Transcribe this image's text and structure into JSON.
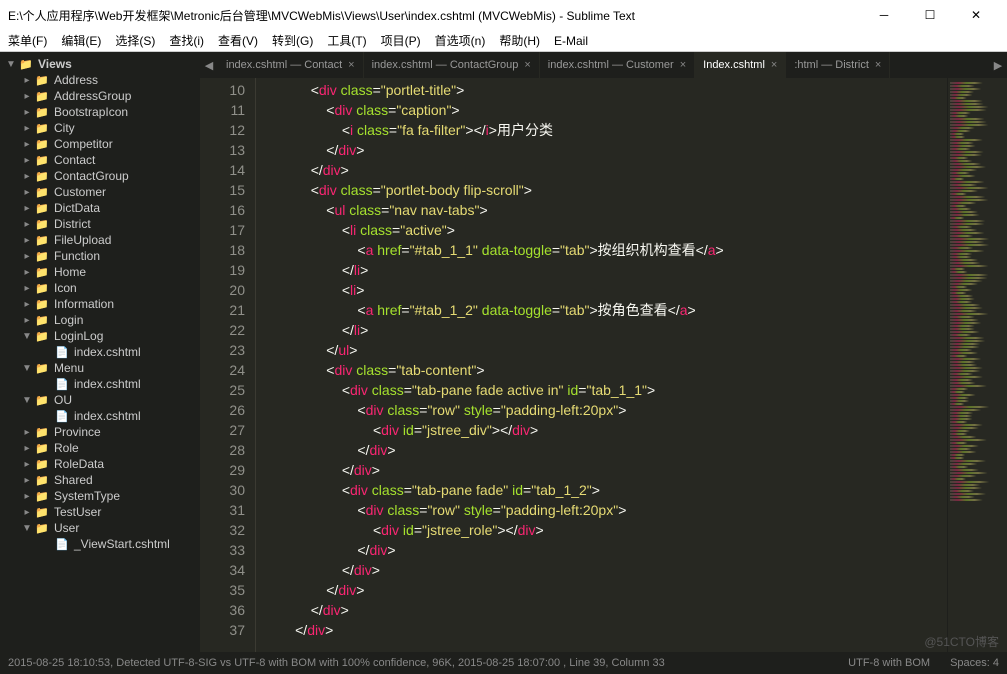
{
  "window": {
    "title": "E:\\个人应用程序\\Web开发框架\\Metronic后台管理\\MVCWebMis\\Views\\User\\index.cshtml (MVCWebMis) - Sublime Text"
  },
  "menu": {
    "items": [
      "菜单(F)",
      "编辑(E)",
      "选择(S)",
      "查找(i)",
      "查看(V)",
      "转到(G)",
      "工具(T)",
      "项目(P)",
      "首选项(n)",
      "帮助(H)",
      "E-Mail"
    ]
  },
  "sidebar": {
    "root": "Views",
    "folders": [
      "Address",
      "AddressGroup",
      "BootstrapIcon",
      "City",
      "Competitor",
      "Contact",
      "ContactGroup",
      "Customer",
      "DictData",
      "District",
      "FileUpload",
      "Function",
      "Home",
      "Icon",
      "Information",
      "Login"
    ],
    "open_folders": [
      {
        "name": "LoginLog",
        "files": [
          "index.cshtml"
        ]
      },
      {
        "name": "Menu",
        "files": [
          "index.cshtml"
        ]
      },
      {
        "name": "OU",
        "files": [
          "index.cshtml"
        ]
      }
    ],
    "folders2": [
      "Province",
      "Role",
      "RoleData",
      "Shared",
      "SystemType",
      "TestUser"
    ],
    "user_folder": {
      "name": "User",
      "files": [
        "_ViewStart.cshtml"
      ]
    }
  },
  "tabs": {
    "items": [
      {
        "label": "index.cshtml — Contact",
        "active": false
      },
      {
        "label": "index.cshtml — ContactGroup",
        "active": false
      },
      {
        "label": "index.cshtml — Customer",
        "active": false
      },
      {
        "label": "Index.cshtml",
        "active": true
      },
      {
        "label": ":html — District",
        "active": false
      }
    ]
  },
  "code": {
    "first_line": 10,
    "lines": [
      "            <div class=\"portlet-title\">",
      "                <div class=\"caption\">",
      "                    <i class=\"fa fa-filter\"></i>用户分类",
      "                </div>",
      "            </div>",
      "            <div class=\"portlet-body flip-scroll\">",
      "                <ul class=\"nav nav-tabs\">",
      "                    <li class=\"active\">",
      "                        <a href=\"#tab_1_1\" data-toggle=\"tab\">按组织机构查看</a>",
      "                    </li>",
      "                    <li>",
      "                        <a href=\"#tab_1_2\" data-toggle=\"tab\">按角色查看</a>",
      "                    </li>",
      "                </ul>",
      "                <div class=\"tab-content\">",
      "                    <div class=\"tab-pane fade active in\" id=\"tab_1_1\">",
      "                        <div class=\"row\" style=\"padding-left:20px\">",
      "                            <div id=\"jstree_div\"></div>",
      "                        </div>",
      "                    </div>",
      "                    <div class=\"tab-pane fade\" id=\"tab_1_2\">",
      "                        <div class=\"row\" style=\"padding-left:20px\">",
      "                            <div id=\"jstree_role\"></div>",
      "                        </div>",
      "                    </div>",
      "                </div>",
      "            </div>",
      "        </div>"
    ]
  },
  "status": {
    "left": "2015-08-25 18:10:53, Detected UTF-8-SIG vs UTF-8 with BOM with 100% confidence, 96K, 2015-08-25 18:07:00 , Line 39, Column 33",
    "encoding": "UTF-8 with BOM",
    "spaces": "Spaces: 4"
  },
  "watermark": "@51CTO博客"
}
